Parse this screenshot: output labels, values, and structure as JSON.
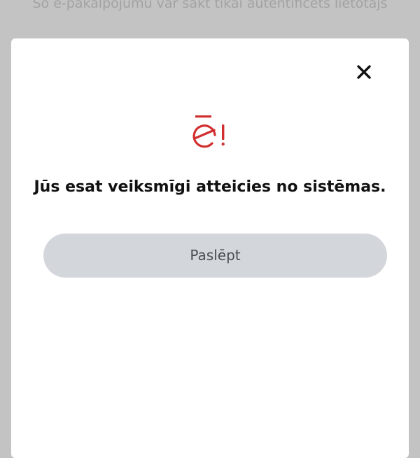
{
  "background": {
    "notice_text": "Šo e-pakalpojumu var sākt tikai autentificēts lietotājs"
  },
  "dialog": {
    "logo_text": "ē!",
    "message": "Jūs esat veiksmīgi atteicies no sistēmas.",
    "hide_button_label": "Paslēpt",
    "close_icon": "close-icon"
  },
  "colors": {
    "backdrop": "#c3c3c3",
    "modal": "#ffffff",
    "logo": "#d12f2f",
    "button_bg": "#d3d6db",
    "button_text": "#4b4f55",
    "message_text": "#111111"
  }
}
